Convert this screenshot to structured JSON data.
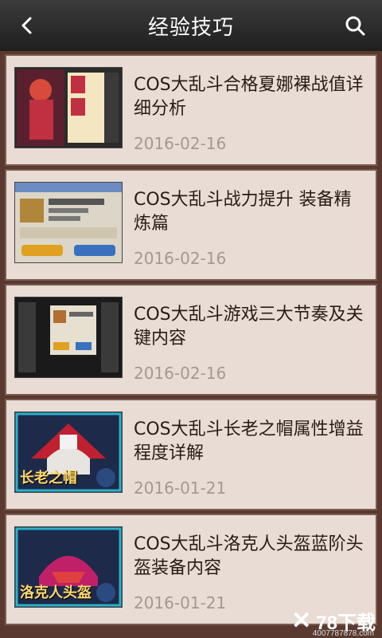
{
  "header": {
    "title": "经验技巧"
  },
  "items": [
    {
      "title": "COS大乱斗合格夏娜裸战值详细分析",
      "date": "2016-02-16"
    },
    {
      "title": "COS大乱斗战力提升 装备精炼篇",
      "date": "2016-02-16"
    },
    {
      "title": "COS大乱斗游戏三大节奏及关键内容",
      "date": "2016-02-16"
    },
    {
      "title": "COS大乱斗长老之帽属性增益程度详解",
      "date": "2016-01-21"
    },
    {
      "title": "COS大乱斗洛克人头盔蓝阶头盔装备内容",
      "date": "2016-01-21"
    }
  ],
  "thumbs": {
    "t4_label": "长老之帽",
    "t5_label": "洛克人头盔"
  },
  "watermark": {
    "brand": "78下载",
    "phone": "4007787878.com"
  }
}
